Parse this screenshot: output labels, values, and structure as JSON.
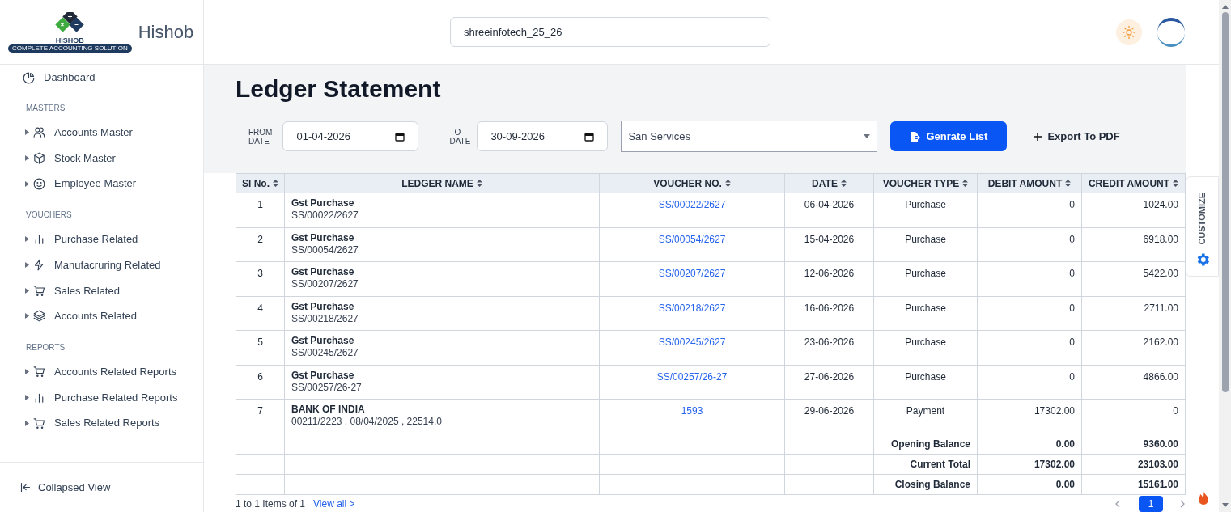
{
  "brand": {
    "logo_text": "HISHOB",
    "logo_tagline": "COMPLETE ACCOUNTING SOLUTION",
    "name": "Hishob"
  },
  "company_field": {
    "value": "shreeinfotech_25_26"
  },
  "sidebar": {
    "top": {
      "label": "Dashboard"
    },
    "sections": [
      {
        "title": "MASTERS",
        "items": [
          {
            "label": "Accounts Master"
          },
          {
            "label": "Stock Master"
          },
          {
            "label": "Employee Master"
          }
        ]
      },
      {
        "title": "VOUCHERS",
        "items": [
          {
            "label": "Purchase Related"
          },
          {
            "label": "Manufacruring Related"
          },
          {
            "label": "Sales Related"
          },
          {
            "label": "Accounts Related"
          }
        ]
      },
      {
        "title": "REPORTS",
        "items": [
          {
            "label": "Accounts Related Reports"
          },
          {
            "label": "Purchase Related Reports"
          },
          {
            "label": "Sales Related Reports"
          }
        ]
      }
    ],
    "footer": "Collapsed View"
  },
  "page_title": "Ledger Statement",
  "filters": {
    "from_label": [
      "FROM",
      "DATE"
    ],
    "from_value": "01-04-2026",
    "to_label": [
      "TO",
      "DATE"
    ],
    "to_value": "30-09-2026",
    "ledger": "San Services",
    "generate_button": "Genrate List",
    "export_button": "Export To PDF"
  },
  "table": {
    "columns": [
      "Sl No.",
      "LEDGER NAME",
      "VOUCHER NO.",
      "DATE",
      "VOUCHER TYPE",
      "DEBIT AMOUNT",
      "CREDIT AMOUNT"
    ],
    "rows": [
      {
        "sl": "1",
        "ledger_name": "Gst Purchase",
        "ledger_detail": "SS/00022/2627",
        "voucher_no": "SS/00022/2627",
        "date": "06-04-2026",
        "voucher_type": "Purchase",
        "debit": "0",
        "credit": "1024.00"
      },
      {
        "sl": "2",
        "ledger_name": "Gst Purchase",
        "ledger_detail": "SS/00054/2627",
        "voucher_no": "SS/00054/2627",
        "date": "15-04-2026",
        "voucher_type": "Purchase",
        "debit": "0",
        "credit": "6918.00"
      },
      {
        "sl": "3",
        "ledger_name": "Gst Purchase",
        "ledger_detail": "SS/00207/2627",
        "voucher_no": "SS/00207/2627",
        "date": "12-06-2026",
        "voucher_type": "Purchase",
        "debit": "0",
        "credit": "5422.00"
      },
      {
        "sl": "4",
        "ledger_name": "Gst Purchase",
        "ledger_detail": "SS/00218/2627",
        "voucher_no": "SS/00218/2627",
        "date": "16-06-2026",
        "voucher_type": "Purchase",
        "debit": "0",
        "credit": "2711.00"
      },
      {
        "sl": "5",
        "ledger_name": "Gst Purchase",
        "ledger_detail": "SS/00245/2627",
        "voucher_no": "SS/00245/2627",
        "date": "23-06-2026",
        "voucher_type": "Purchase",
        "debit": "0",
        "credit": "2162.00"
      },
      {
        "sl": "6",
        "ledger_name": "Gst Purchase",
        "ledger_detail": "SS/00257/26-27",
        "voucher_no": "SS/00257/26-27",
        "date": "27-06-2026",
        "voucher_type": "Purchase",
        "debit": "0",
        "credit": "4866.00"
      },
      {
        "sl": "7",
        "ledger_name": "BANK OF INDIA",
        "ledger_detail": "00211/2223 , 08/04/2025 , 22514.0",
        "voucher_no": "1593",
        "date": "29-06-2026",
        "voucher_type": "Payment",
        "debit": "17302.00",
        "credit": "0"
      }
    ],
    "summary": [
      {
        "label": "Opening Balance",
        "debit": "0.00",
        "credit": "9360.00"
      },
      {
        "label": "Current Total",
        "debit": "17302.00",
        "credit": "23103.00"
      },
      {
        "label": "Closing Balance",
        "debit": "0.00",
        "credit": "15161.00"
      }
    ]
  },
  "pagination": {
    "info": "1 to 1 Items of 1",
    "view_all": "View all >",
    "pages": [
      {
        "label": "1",
        "selected": true
      }
    ]
  },
  "customize_tab": "CUSTOMIZE"
}
